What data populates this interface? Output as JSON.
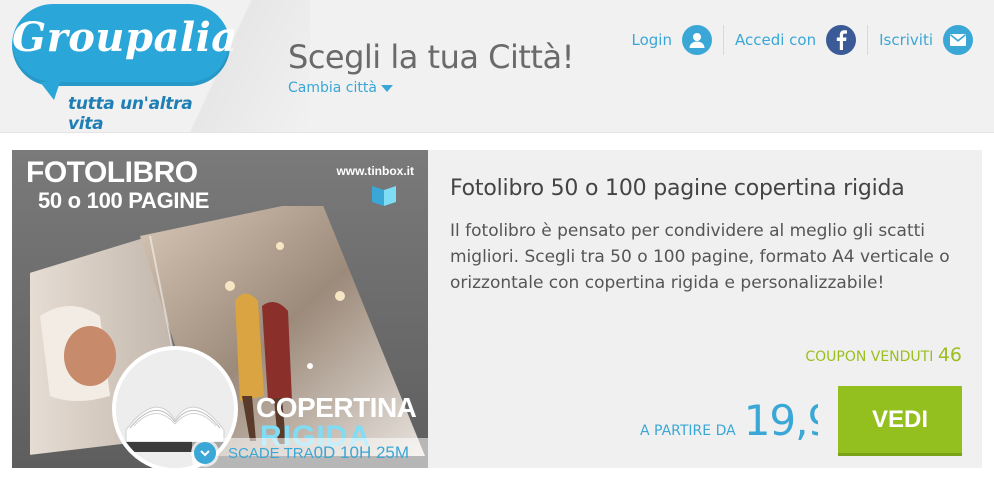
{
  "header": {
    "logo": {
      "name": "Groupalia",
      "tagline": "tutta un'altra vita"
    },
    "city_title": "Scegli la tua Città!",
    "city_change": "Cambia città",
    "links": {
      "login": "Login",
      "accedi": "Accedi con",
      "iscriviti": "Iscriviti"
    }
  },
  "deal": {
    "image": {
      "title_line1": "FOTOLIBRO",
      "title_line2": "50 o 100 PAGINE",
      "brand": "www.tinbox.it",
      "label_copertina": "COPERTINA",
      "label_rigida": "RIGIDA"
    },
    "timer": {
      "label": "SCADE TRA",
      "value": "0D 10H 25M"
    },
    "title": "Fotolibro 50 o 100 pagine copertina rigida",
    "description": "Il fotolibro è pensato per condividere al meglio gli scatti migliori. Scegli tra 50 o 100 pagine, formato A4 verticale o orizzontale con copertina rigida e personalizzabile!",
    "coupons_label": "COUPON VENDUTI",
    "coupons_value": "46",
    "price_label": "A PARTIRE DA",
    "price_value": "19,9",
    "button_label": "VEDI"
  },
  "colors": {
    "accent_blue": "#3aa7d6",
    "logo_blue": "#2aa6d9",
    "green": "#93c01f",
    "facebook": "#3b5a98"
  }
}
